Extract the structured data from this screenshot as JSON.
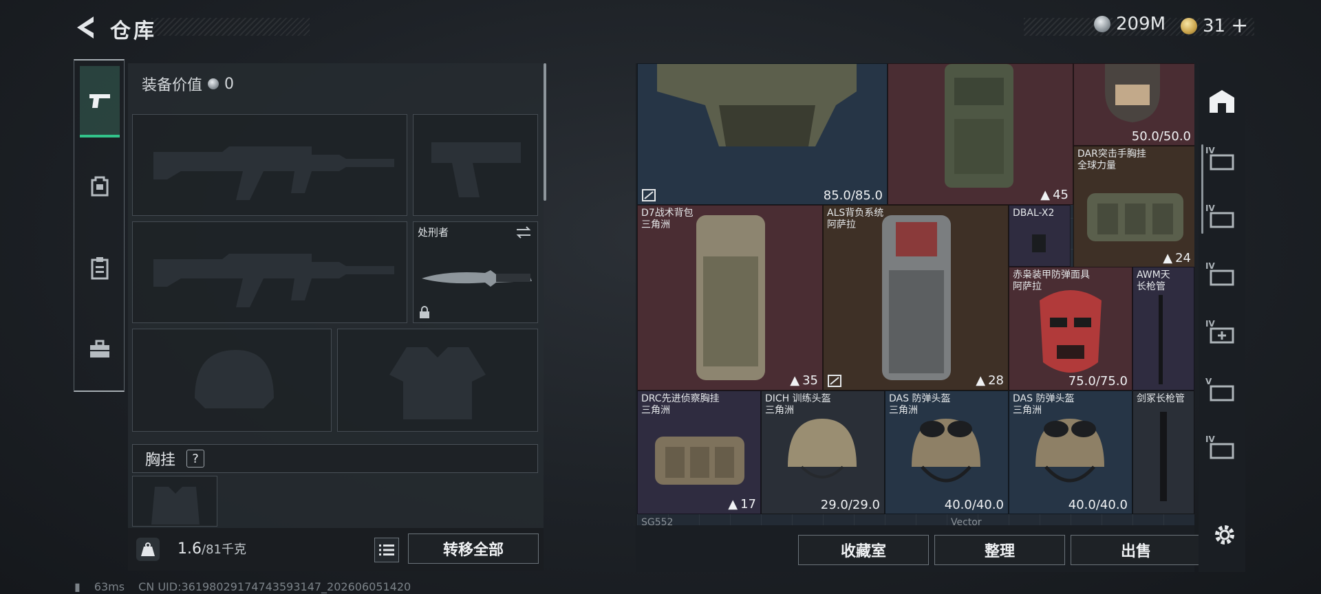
{
  "header": {
    "title": "仓库",
    "currencies": [
      {
        "icon": "silver-coin-icon",
        "value": "209M"
      },
      {
        "icon": "gold-coin-icon",
        "value": "31",
        "suffix": "+"
      }
    ]
  },
  "left_tabs": [
    {
      "name": "weapons-tab",
      "icon": "pistol-icon",
      "active": true
    },
    {
      "name": "backpack-tab",
      "icon": "backpack-icon",
      "active": false
    },
    {
      "name": "clipboard-tab",
      "icon": "clipboard-icon",
      "active": false
    },
    {
      "name": "toolbox-tab",
      "icon": "toolbox-icon",
      "active": false
    }
  ],
  "equipment": {
    "value_label": "装备价值",
    "value": "0",
    "melee_label": "处刑者",
    "vest_label": "胸挂",
    "vest_help": "?",
    "weight_current": "1.6",
    "weight_max": "/81千克",
    "transfer_all": "转移全部"
  },
  "stash": {
    "items": [
      {
        "id": "armor-top",
        "name": "",
        "value": "85.0/85.0"
      },
      {
        "id": "backpack-red",
        "name": "",
        "tag": "45"
      },
      {
        "id": "helmet-top",
        "name": "",
        "value": "50.0/50.0"
      },
      {
        "id": "dar-vest",
        "name": "DAR突击手胸挂",
        "sub": "全球力量",
        "tag": "24"
      },
      {
        "id": "d7-pack",
        "name": "D7战术背包",
        "sub": "三角洲",
        "tag": "35"
      },
      {
        "id": "als-pack",
        "name": "ALS背负系统",
        "sub": "阿萨拉",
        "tag": "28"
      },
      {
        "id": "dbal",
        "name": "DBAL-X2",
        "sub": ""
      },
      {
        "id": "red-mask",
        "name": "赤枭装甲防弹面具",
        "sub": "阿萨拉",
        "value": "75.0/75.0"
      },
      {
        "id": "awm-barrel",
        "name": "AWM天",
        "sub": "长枪管"
      },
      {
        "id": "drc-vest",
        "name": "DRC先进侦察胸挂",
        "sub": "三角洲",
        "tag": "17"
      },
      {
        "id": "dich-helmet",
        "name": "DICH 训练头盔",
        "sub": "三角洲",
        "value": "29.0/29.0"
      },
      {
        "id": "das-helmet-1",
        "name": "DAS 防弹头盔",
        "sub": "三角洲",
        "value": "40.0/40.0"
      },
      {
        "id": "das-helmet-2",
        "name": "DAS 防弹头盔",
        "sub": "三角洲",
        "value": "40.0/40.0"
      },
      {
        "id": "sword-barrel",
        "name": "剑冢长枪管",
        "sub": ""
      }
    ],
    "bottom_labels": [
      "SG552",
      "Vector"
    ],
    "actions": [
      "收藏室",
      "整理",
      "出售"
    ]
  },
  "right_tabs": [
    {
      "name": "home-tab",
      "level": ""
    },
    {
      "name": "storage-iv-1",
      "level": "IV"
    },
    {
      "name": "storage-iv-2",
      "level": "IV"
    },
    {
      "name": "storage-iv-3",
      "level": "IV"
    },
    {
      "name": "storage-iv-add",
      "level": "IV"
    },
    {
      "name": "storage-v",
      "level": "V"
    },
    {
      "name": "storage-iv-4",
      "level": "IV"
    }
  ],
  "footer": {
    "ping": "63ms",
    "uid": "CN UID:36198029174743593147_202606051420"
  },
  "colors": {
    "accent_green": "#32c38a",
    "item_red": "#4a2d33",
    "item_blue": "#263546",
    "item_brown": "#3e3026",
    "item_purple": "#2f2c40"
  }
}
